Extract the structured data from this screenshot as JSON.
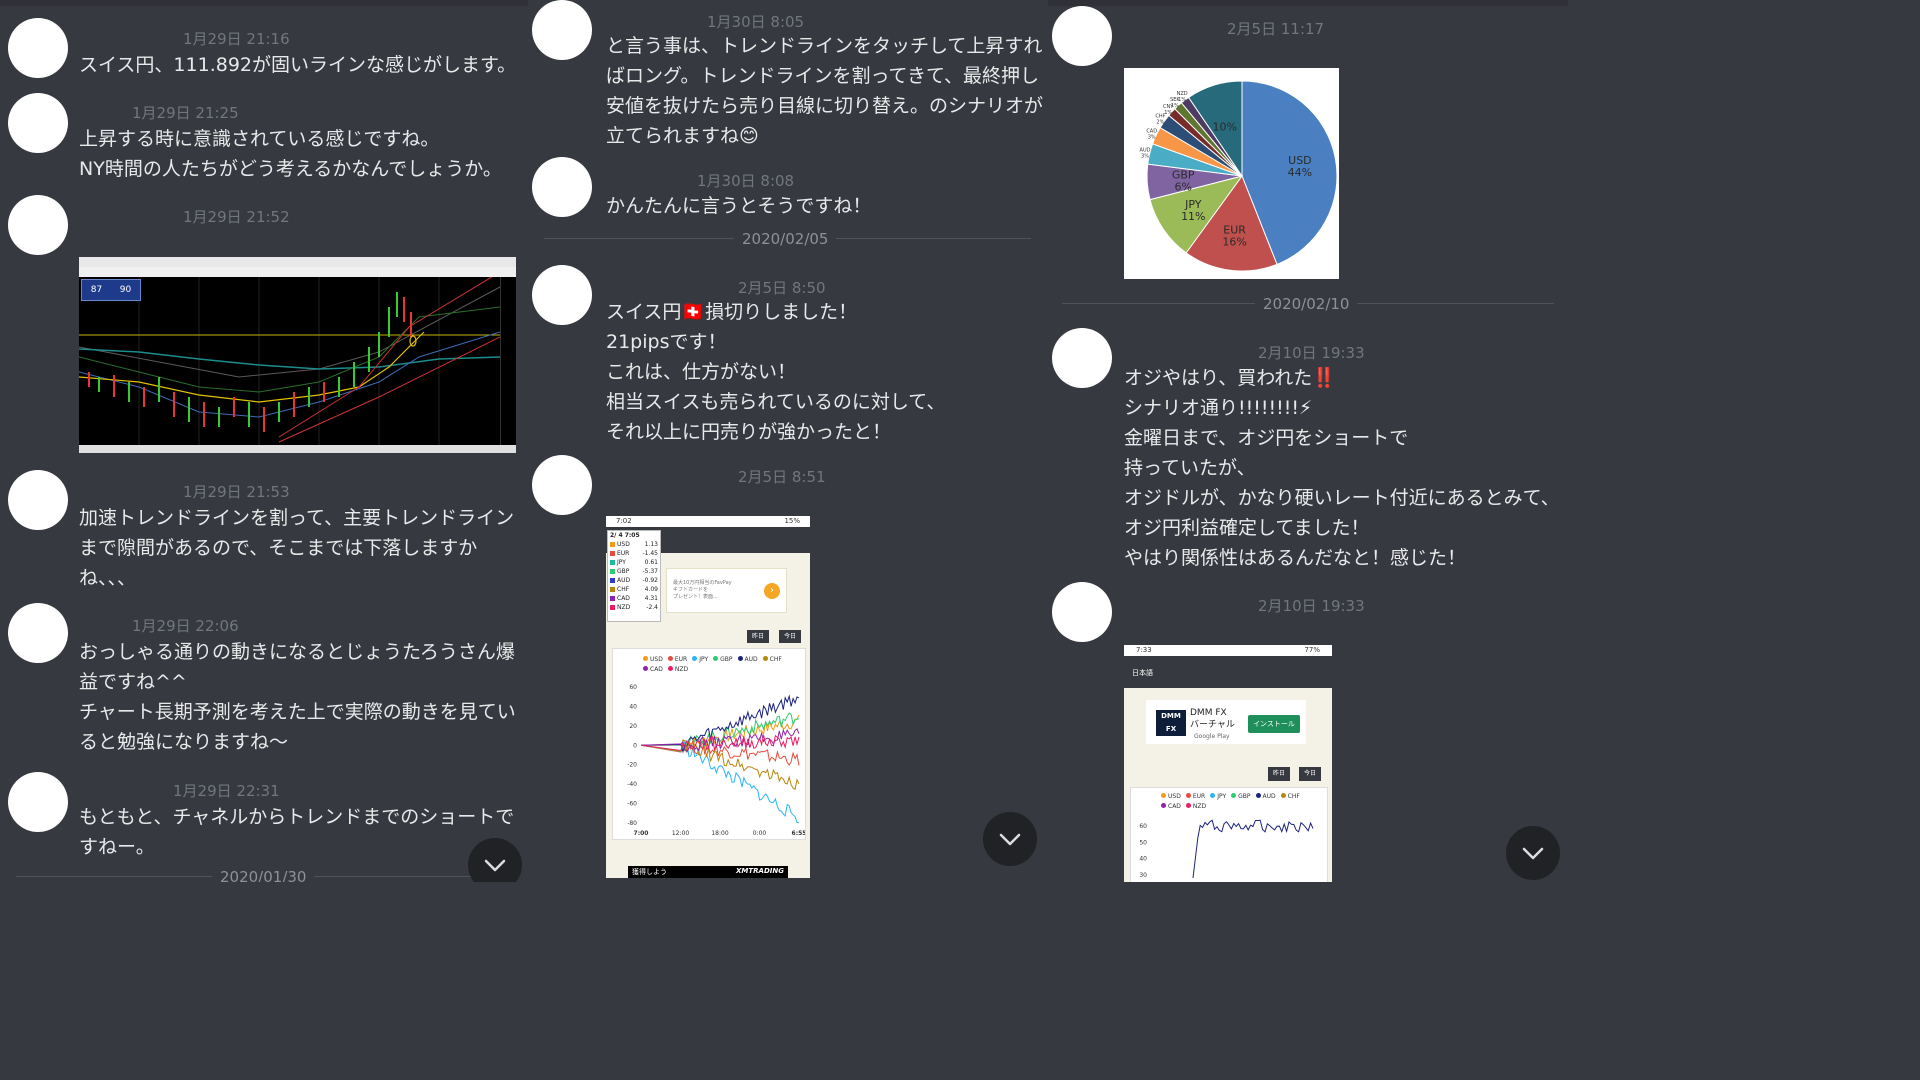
{
  "column1": {
    "messages": [
      {
        "time": "1月29日 21:16",
        "text": "スイス円、111.892が固いラインな感じがします。"
      },
      {
        "time": "1月29日 21:25",
        "text": "上昇する時に意識されている感じですね。\nNY時間の人たちがどう考えるかなんでしょうか。"
      },
      {
        "time": "1月29日 21:52",
        "text": ""
      },
      {
        "time": "1月29日 21:53",
        "text": "加速トレンドラインを割って、主要トレンドライン\nまで隙間があるので、そこまでは下落しますか\nね、、、"
      },
      {
        "time": "1月29日 22:06",
        "text": "おっしゃる通りの動きになるとじょうたろうさん爆\n益ですね^^\nチャート長期予測を考えた上で実際の動きを見てい\nると勉強になりますね〜"
      },
      {
        "time": "1月29日 22:31",
        "text": "もともと、チャネルからトレンドまでのショートで\nすねー。"
      }
    ],
    "date_divider": "2020/01/30",
    "chart_badges": {
      "sell": "87",
      "buy": "90"
    }
  },
  "column2": {
    "messages": [
      {
        "time": "1月30日 8:05",
        "text": "と言う事は、トレンドラインをタッチして上昇すれ\nばロング。トレンドラインを割ってきて、最終押し\n安値を抜けたら売り目線に切り替え。のシナリオが\n立てられますね😊"
      },
      {
        "time": "1月30日 8:08",
        "text": "かんたんに言うとそうですね！"
      },
      {
        "time": "2月5日 8:50",
        "text": "スイス円🇨🇭損切りしました！\n21pipsです！\nこれは、仕方がない！\n相当スイスも売られているのに対して、\nそれ以上に円売りが強かったと！"
      },
      {
        "time": "2月5日 8:51",
        "text": ""
      }
    ],
    "date_divider": "2020/02/05",
    "phone": {
      "status_time": "7:02",
      "battery": "15%",
      "panel_time": "2/ 4 7:05",
      "strength": [
        {
          "cur": "USD",
          "val": "1.13",
          "color": "#f39c12"
        },
        {
          "cur": "EUR",
          "val": "-1.45",
          "color": "#e74c3c"
        },
        {
          "cur": "JPY",
          "val": "0.61",
          "color": "#1abc9c"
        },
        {
          "cur": "GBP",
          "val": "-5.37",
          "color": "#2ecc71"
        },
        {
          "cur": "AUD",
          "val": "-0.92",
          "color": "#2c3ec9"
        },
        {
          "cur": "CHF",
          "val": "4.09",
          "color": "#b8860b"
        },
        {
          "cur": "CAD",
          "val": "4.31",
          "color": "#8e24aa"
        },
        {
          "cur": "NZD",
          "val": "-2.4",
          "color": "#e91e63"
        }
      ],
      "ad_text": "最大10万円相当のFavPay\nギフトカードを\nプレゼント！表面...",
      "btn_yesterday": "昨日",
      "btn_today": "今日",
      "legend": [
        {
          "cur": "USD",
          "color": "#f39c12"
        },
        {
          "cur": "EUR",
          "color": "#e74c3c"
        },
        {
          "cur": "JPY",
          "color": "#29b6f6"
        },
        {
          "cur": "GBP",
          "color": "#2ecc71"
        },
        {
          "cur": "AUD",
          "color": "#1a237e"
        },
        {
          "cur": "CHF",
          "color": "#b8860b"
        },
        {
          "cur": "CAD",
          "color": "#8e24aa"
        },
        {
          "cur": "NZD",
          "color": "#e91e63"
        }
      ],
      "yticks": [
        "60",
        "40",
        "20",
        "0",
        "-20",
        "-40",
        "-60",
        "-80"
      ],
      "xticks": [
        "7:00",
        "12:00",
        "18:00",
        "0:00",
        "6:55"
      ],
      "footer_left": "獲得しよう",
      "footer_brand": "XMTRADING"
    }
  },
  "column3": {
    "messages": [
      {
        "time": "2月5日 11:17",
        "text": ""
      },
      {
        "time": "2月10日 19:33",
        "text": "オジやはり、買われた‼️\nシナリオ通り!!!!!!!!⚡\n金曜日まで、オジ円をショートで\n持っていたが、\nオジドルが、かなり硬いレート付近にあるとみて、\nオジ円利益確定してました！\nやはり関係性はあるんだなと！感じた！"
      },
      {
        "time": "2月10日 19:33",
        "text": ""
      }
    ],
    "date_divider": "2020/02/10",
    "pie": {
      "slices": [
        {
          "label": "USD",
          "pct": "44%",
          "value": 44,
          "color": "#4a7fc1"
        },
        {
          "label": "EUR",
          "pct": "16%",
          "value": 16,
          "color": "#c0504d"
        },
        {
          "label": "JPY",
          "pct": "11%",
          "value": 11,
          "color": "#9bbb59"
        },
        {
          "label": "GBP",
          "pct": "6%",
          "value": 6,
          "color": "#8064a2"
        },
        {
          "label": "AUD",
          "pct": "3%",
          "value": 3.5,
          "color": "#4bacc6"
        },
        {
          "label": "CAD",
          "pct": "3%",
          "value": 3,
          "color": "#f79646"
        },
        {
          "label": "CHF",
          "pct": "2%",
          "value": 2.5,
          "color": "#2c4d75"
        },
        {
          "label": "CNY",
          "pct": "1%",
          "value": 1.5,
          "color": "#772c2a"
        },
        {
          "label": "SEK",
          "pct": "1%",
          "value": 1.5,
          "color": "#5f7530"
        },
        {
          "label": "NZD",
          "pct": "1%",
          "value": 1.5,
          "color": "#4d3b62"
        },
        {
          "label": "Other",
          "pct": "10%",
          "value": 9.5,
          "color": "#276a7c"
        }
      ]
    },
    "phone2": {
      "status_time": "7:33",
      "battery": "77%",
      "lang": "日本語",
      "ad_title": "DMM FX\nバーチャル",
      "ad_sub": "Google Play",
      "install": "インストール",
      "btn_yesterday": "昨日",
      "btn_today": "今日",
      "legend": [
        {
          "cur": "USD",
          "color": "#f39c12"
        },
        {
          "cur": "EUR",
          "color": "#e74c3c"
        },
        {
          "cur": "JPY",
          "color": "#29b6f6"
        },
        {
          "cur": "GBP",
          "color": "#2ecc71"
        },
        {
          "cur": "AUD",
          "color": "#1a237e"
        },
        {
          "cur": "CHF",
          "color": "#b8860b"
        },
        {
          "cur": "CAD",
          "color": "#8e24aa"
        },
        {
          "cur": "NZD",
          "color": "#e91e63"
        }
      ],
      "yticks": [
        "60",
        "50",
        "40",
        "30"
      ]
    }
  }
}
